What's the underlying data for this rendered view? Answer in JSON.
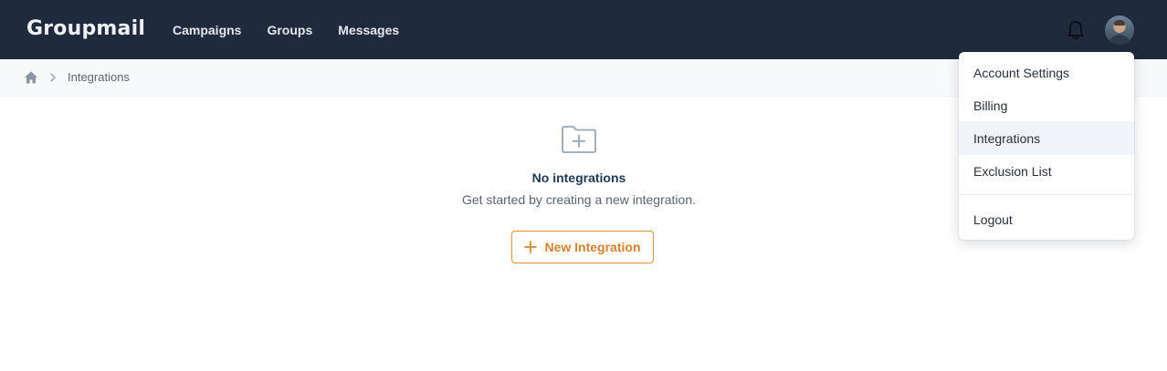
{
  "app": {
    "logo": "Groupmail"
  },
  "nav": {
    "items": [
      {
        "label": "Campaigns"
      },
      {
        "label": "Groups"
      },
      {
        "label": "Messages"
      }
    ]
  },
  "header_icons": {
    "notifications": "bell-icon",
    "avatar": "user-avatar"
  },
  "breadcrumb": {
    "home_icon": "home-icon",
    "separator_icon": "chevron-right-icon",
    "current": "Integrations"
  },
  "empty_state": {
    "icon": "folder-plus-icon",
    "title": "No integrations",
    "subtitle": "Get started by creating a new integration.",
    "button_label": "New Integration",
    "button_icon": "plus-icon"
  },
  "user_menu": {
    "items": [
      {
        "label": "Account Settings"
      },
      {
        "label": "Billing"
      },
      {
        "label": "Integrations",
        "active": true
      },
      {
        "label": "Exclusion List"
      },
      {
        "label": "Logout"
      }
    ]
  },
  "colors": {
    "topbar": "#1f2a3c",
    "accent": "#d9822b",
    "title": "#1d3a55"
  }
}
